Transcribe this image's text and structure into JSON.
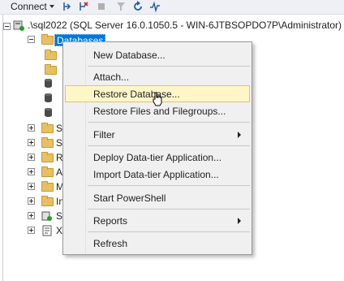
{
  "toolbar": {
    "connect_label": "Connect",
    "icons": [
      "connect-icon",
      "disconnect-icon",
      "stop-icon",
      "filter-icon",
      "refresh-icon",
      "activity-monitor-icon"
    ]
  },
  "tree": {
    "server_node": ".\\sql2022 (SQL Server 16.0.1050.5 - WIN-6JTBSOPDO7P\\Administrator)",
    "selected_node": "Databases",
    "partial_labels": [
      "S",
      "S",
      "R",
      "A",
      "M",
      "In",
      "S",
      "X"
    ]
  },
  "context_menu": {
    "items": [
      {
        "label": "New Database...",
        "submenu": false
      },
      {
        "label": "Attach...",
        "submenu": false
      },
      {
        "label": "Restore Database...",
        "submenu": false,
        "hovered": true
      },
      {
        "label": "Restore Files and Filegroups...",
        "submenu": false
      },
      {
        "label": "Filter",
        "submenu": true
      },
      {
        "label": "Deploy Data-tier Application...",
        "submenu": false
      },
      {
        "label": "Import Data-tier Application...",
        "submenu": false
      },
      {
        "label": "Start PowerShell",
        "submenu": false
      },
      {
        "label": "Reports",
        "submenu": true
      },
      {
        "label": "Refresh",
        "submenu": false
      }
    ]
  },
  "colors": {
    "selection": "#0078d7",
    "menu_hover": "#fff6c8",
    "folder": "#e8c062"
  }
}
